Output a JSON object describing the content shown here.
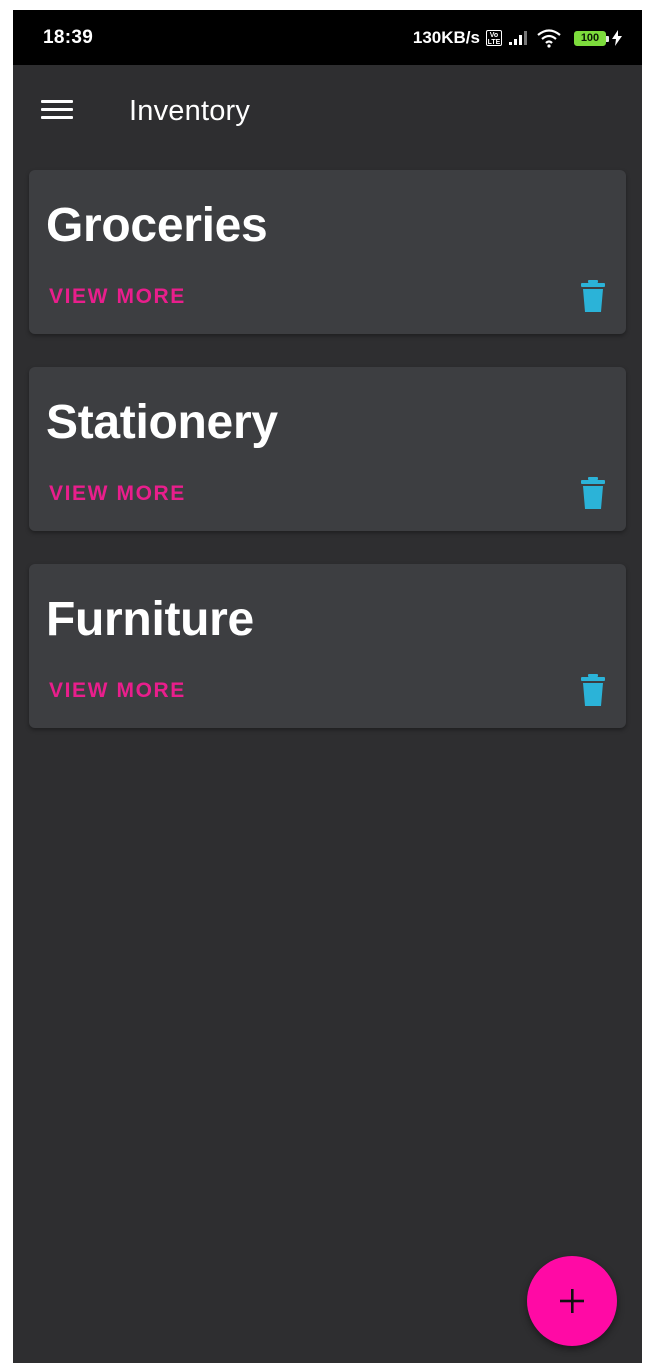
{
  "status_bar": {
    "time": "18:39",
    "net_speed": "130KB/s",
    "volte": "Vo LTE",
    "battery": "100",
    "icons": [
      "volte-icon",
      "signal-icon",
      "wifi-icon",
      "battery-icon",
      "charging-bolt-icon"
    ]
  },
  "app_bar": {
    "title": "Inventory",
    "menu_icon": "hamburger-menu-icon"
  },
  "categories": [
    {
      "title": "Groceries",
      "action_label": "VIEW MORE",
      "delete_icon": "trash-icon"
    },
    {
      "title": "Stationery",
      "action_label": "VIEW MORE",
      "delete_icon": "trash-icon"
    },
    {
      "title": "Furniture",
      "action_label": "VIEW MORE",
      "delete_icon": "trash-icon"
    }
  ],
  "fab": {
    "icon": "plus-icon"
  },
  "colors": {
    "background": "#2e2e30",
    "card": "#3d3e41",
    "accent_text": "#e91e8c",
    "delete_icon": "#2bb3d8",
    "fab": "#ff0aa5",
    "battery": "#7ddc3c"
  }
}
